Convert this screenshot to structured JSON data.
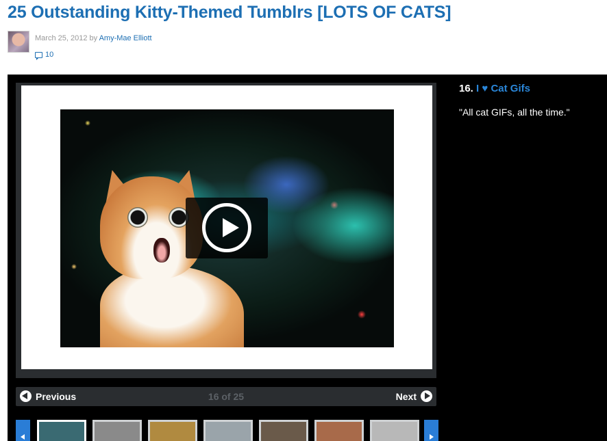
{
  "article": {
    "title": "25 Outstanding Kitty-Themed Tumblrs [LOTS OF CATS]",
    "date_prefix": "March 25, 2012 by ",
    "author": "Amy-Mae Elliott",
    "comment_count": "10"
  },
  "slide": {
    "number": "16.",
    "title": "I ♥ Cat Gifs",
    "description": "\"All cat GIFs, all the time.\"",
    "image_icon": "play-icon"
  },
  "nav": {
    "previous_label": "Previous",
    "next_label": "Next",
    "counter": "16 of 25"
  },
  "thumbnails": [
    {
      "id": "thumb-1",
      "active": true,
      "color": "#3a6a72"
    },
    {
      "id": "thumb-2",
      "active": false,
      "color": "#8a8a8a"
    },
    {
      "id": "thumb-3",
      "active": false,
      "color": "#b08a40"
    },
    {
      "id": "thumb-4",
      "active": false,
      "color": "#9aa4aa"
    },
    {
      "id": "thumb-5",
      "active": false,
      "color": "#6a5a4a"
    },
    {
      "id": "thumb-6",
      "active": false,
      "color": "#a86a4a"
    },
    {
      "id": "thumb-7",
      "active": false,
      "color": "#b8b8b8"
    }
  ],
  "colors": {
    "link": "#1d6fb3",
    "accent": "#2a7dd6",
    "gallery_bg": "#000000",
    "nav_bg": "#2a2d30"
  }
}
